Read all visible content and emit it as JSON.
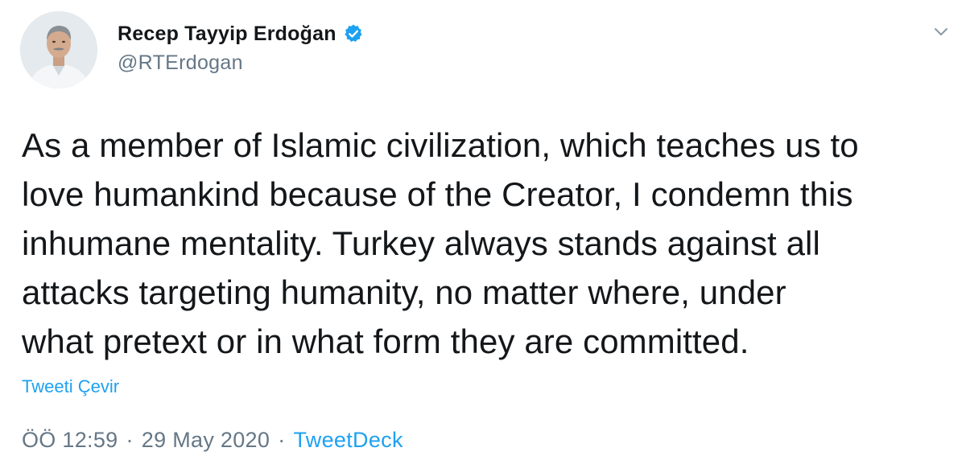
{
  "author": {
    "display_name": "Recep Tayyip Erdoğan",
    "handle": "@RTErdogan",
    "verified": true
  },
  "tweet": {
    "text": "As a member of Islamic civilization, which teaches us to\nlove humankind because of the Creator, I condemn this\ninhumane mentality. Turkey always stands against all\nattacks targeting humanity, no matter where, under\nwhat pretext or in what form they are committed.",
    "translate_label": "Tweeti Çevir",
    "time": "ÖÖ 12:59",
    "date": "29 May 2020",
    "separator": "·",
    "source": "TweetDeck"
  },
  "icons": {
    "verified": "verified-badge-icon",
    "more": "chevron-down-icon",
    "avatar": "profile-photo"
  },
  "colors": {
    "accent": "#1da1f2",
    "text": "#14171a",
    "secondary": "#657786"
  }
}
